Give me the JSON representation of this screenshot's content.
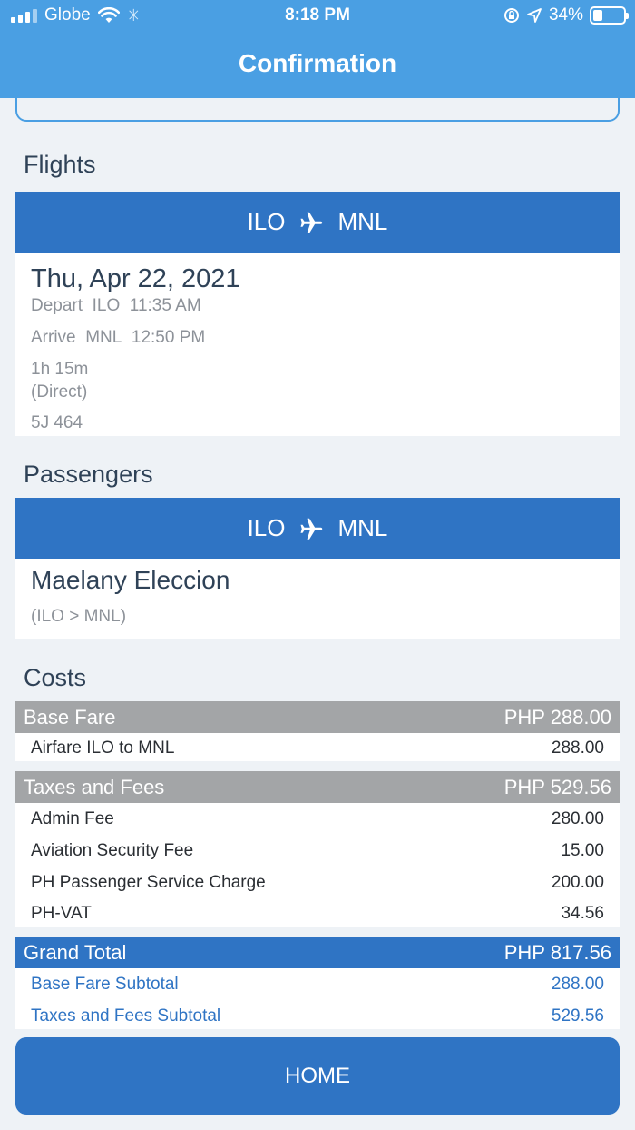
{
  "status": {
    "carrier": "Globe",
    "time": "8:18 PM",
    "battery": "34%"
  },
  "header": {
    "title": "Confirmation"
  },
  "flights": {
    "title": "Flights",
    "route": {
      "from": "ILO",
      "to": "MNL"
    },
    "date": "Thu, Apr 22, 2021",
    "depart_label": "Depart",
    "depart_code": "ILO",
    "depart_time": "11:35 AM",
    "arrive_label": "Arrive",
    "arrive_code": "MNL",
    "arrive_time": "12:50 PM",
    "duration": "1h 15m",
    "stops": "(Direct)",
    "flight_no": "5J 464"
  },
  "passengers": {
    "title": "Passengers",
    "route": {
      "from": "ILO",
      "to": "MNL"
    },
    "name": "Maelany Eleccion",
    "segment": "(ILO > MNL)"
  },
  "costs": {
    "title": "Costs",
    "base_fare": {
      "label": "Base Fare",
      "total": "PHP 288.00",
      "items": [
        {
          "label": "Airfare ILO to MNL",
          "value": "288.00"
        }
      ]
    },
    "taxes": {
      "label": "Taxes and Fees",
      "total": "PHP 529.56",
      "items": [
        {
          "label": "Admin Fee",
          "value": "280.00"
        },
        {
          "label": "Aviation Security Fee",
          "value": "15.00"
        },
        {
          "label": "PH Passenger Service Charge",
          "value": "200.00"
        },
        {
          "label": "PH-VAT",
          "value": "34.56"
        }
      ]
    },
    "grand_total": {
      "label": "Grand Total",
      "total": "PHP 817.56",
      "items": [
        {
          "label": "Base Fare Subtotal",
          "value": "288.00"
        },
        {
          "label": "Taxes and Fees Subtotal",
          "value": "529.56"
        }
      ]
    }
  },
  "home_button": "HOME",
  "colors": {
    "header": "#4a9fe3",
    "primary": "#2f74c4",
    "grey_header": "#a3a5a7",
    "background": "#eef2f6"
  }
}
